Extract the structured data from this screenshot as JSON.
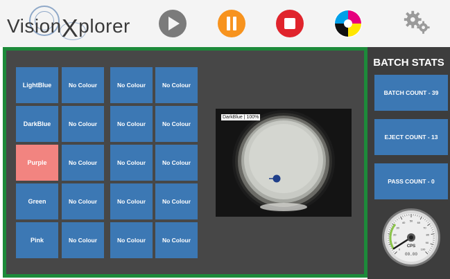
{
  "app": {
    "logo": {
      "part1": "Vision",
      "x": "X",
      "part2": "plorer"
    }
  },
  "toolbar": {
    "play_icon": "play-icon",
    "pause_icon": "pause-icon",
    "stop_icon": "stop-icon",
    "colour_icon": "colour-wheel-icon",
    "settings_icon": "gears-icon",
    "colors": {
      "play": "#7b7b7b",
      "pause": "#f7931e",
      "stop": "#e0242c"
    }
  },
  "colour_grid": {
    "rows": [
      [
        "LightBlue",
        "No Colour",
        "No Colour",
        "No Colour"
      ],
      [
        "DarkBlue",
        "No Colour",
        "No Colour",
        "No Colour"
      ],
      [
        "Purple",
        "No Colour",
        "No Colour",
        "No Colour"
      ],
      [
        "Green",
        "No Colour",
        "No Colour",
        "No Colour"
      ],
      [
        "Pink",
        "No Colour",
        "No Colour",
        "No Colour"
      ]
    ],
    "active": {
      "row": 2,
      "col": 0
    },
    "colors": {
      "cell": "#3c78b4",
      "active": "#f28480",
      "panel_border": "#1d8a3a"
    }
  },
  "camera": {
    "overlay_label": "DarkBlue | 100%"
  },
  "batch_stats": {
    "title": "BATCH STATS",
    "batch_count": "BATCH COUNT - 39",
    "eject_count": "EJECT COUNT - 13",
    "pass_count": "PASS COUNT - 0"
  },
  "gauge": {
    "unit": "CPS",
    "readout": "00.00",
    "ticks": [
      "0",
      "10",
      "20",
      "30",
      "40",
      "50",
      "60",
      "70",
      "80",
      "90",
      "100"
    ]
  }
}
